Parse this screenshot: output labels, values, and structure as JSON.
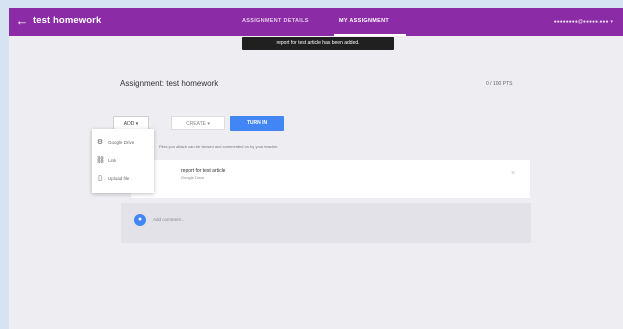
{
  "header": {
    "back_icon": "←",
    "title": "test homework",
    "tabs": [
      {
        "label": "ASSIGNMENT DETAILS",
        "active": false
      },
      {
        "label": "MY ASSIGNMENT",
        "active": true
      }
    ],
    "user_email": "●●●●●●●●@●●●●●.●●●",
    "user_menu_caret": "▾"
  },
  "toast": {
    "text": "report for test article has been added."
  },
  "assignment": {
    "title": "Assignment: test homework",
    "points": "0 / 100 PTS"
  },
  "actions": {
    "add_label": "ADD ▾",
    "create_label": "CREATE ▾",
    "turn_in_label": "TURN IN"
  },
  "hint": "Files you attach can be viewed and commented on by your teacher",
  "add_menu": {
    "items": [
      {
        "icon": "⚙",
        "icon_name": "google-drive-icon",
        "label": "Google Drive"
      },
      {
        "icon": "⛓",
        "icon_name": "link-icon",
        "label": "Link"
      },
      {
        "icon": "▯",
        "icon_name": "upload-file-icon",
        "label": "Upload file"
      }
    ]
  },
  "attachment": {
    "title": "report for test article",
    "subtitle": "Google Docs",
    "remove_icon": "×"
  },
  "comment": {
    "avatar_glyph": "●",
    "placeholder": "Add comment..."
  },
  "colors": {
    "brand": "#8c2ba6",
    "primary_button": "#4285f4",
    "background": "#eeeef2"
  }
}
